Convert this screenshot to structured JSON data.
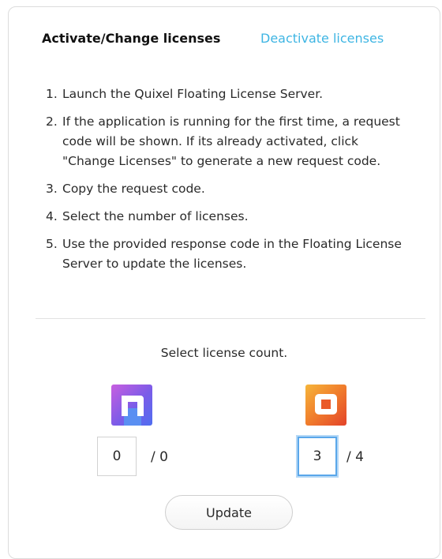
{
  "tabs": {
    "activate_label": "Activate/Change licenses",
    "deactivate_label": "Deactivate licenses"
  },
  "steps": [
    {
      "num": "1.",
      "text": "Launch the Quixel Floating License Server."
    },
    {
      "num": "2.",
      "text": "If the application is running for the first time, a request code will be shown. If its already activated, click \"Change Licenses\" to generate a new request code."
    },
    {
      "num": "3.",
      "text": "Copy the request code."
    },
    {
      "num": "4.",
      "text": "Select the number of licenses."
    },
    {
      "num": "5.",
      "text": "Use the provided response code in the Floating License Server to update the licenses."
    }
  ],
  "license_count": {
    "label": "Select license count.",
    "products": [
      {
        "icon": "purple-n-logo-icon",
        "value": "0",
        "total": "/ 0",
        "color": "#7a5ce8"
      },
      {
        "icon": "orange-d-logo-icon",
        "value": "3",
        "total": "/ 4",
        "color": "#f07c2c"
      }
    ]
  },
  "update_button": {
    "label": "Update"
  },
  "colors": {
    "link": "#3eb5e3",
    "focus": "#5aa7ea"
  }
}
